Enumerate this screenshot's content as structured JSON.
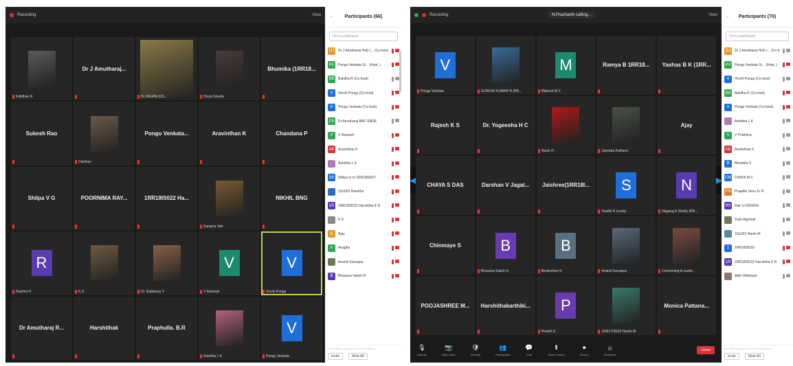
{
  "colors": {
    "accent_blue": "#1e6fd9",
    "mic_red": "#d33333",
    "highlight": "#c8d24a",
    "end_red": "#d9333b"
  },
  "left": {
    "recording": "Recording",
    "view": "View",
    "tiles": [
      {
        "type": "photo",
        "label": "Kalidhas N",
        "photo": "#5a5a5a"
      },
      {
        "type": "name",
        "name": "Dr J Amutharaj...",
        "label": ""
      },
      {
        "type": "photo",
        "label": "Dr. RAJAN (Ch...",
        "photo": "#8a7a45",
        "wide": true
      },
      {
        "type": "photo",
        "label": "Divya Gowda",
        "photo": "#4a3a3a"
      },
      {
        "type": "name",
        "name": "Bhumika (1RR18...",
        "label": ""
      },
      {
        "type": "name",
        "name": "Sukesh Rao",
        "label": ""
      },
      {
        "type": "photo",
        "label": "Chethan",
        "photo": "#6a5848"
      },
      {
        "type": "name",
        "name": "Pongu Venkata...",
        "label": ""
      },
      {
        "type": "name",
        "name": "Aravinthan K",
        "label": ""
      },
      {
        "type": "name",
        "name": "Chandana P",
        "label": ""
      },
      {
        "type": "name",
        "name": "Shilpa V G",
        "label": ""
      },
      {
        "type": "name",
        "name": "POORNIMA RAY...",
        "label": ""
      },
      {
        "type": "name",
        "name": "1RR18IS022 Ha...",
        "label": ""
      },
      {
        "type": "photo",
        "label": "Sanjana Jain",
        "photo": "#7a5a30"
      },
      {
        "type": "name",
        "name": "NIKHIL BNG",
        "label": ""
      },
      {
        "type": "avatar",
        "letter": "R",
        "color": "#5a3bb0",
        "label": "Rashmi H"
      },
      {
        "type": "photo",
        "label": "K.S",
        "photo": "#6e5a40"
      },
      {
        "type": "photo",
        "label": "Dr. Subbarao T",
        "photo": "#8a6048"
      },
      {
        "type": "avatar",
        "letter": "V",
        "color": "#1c8a6e",
        "label": "V Ramesh"
      },
      {
        "type": "avatar",
        "letter": "V",
        "color": "#1e6fd9",
        "label": "Vinchi Pongu",
        "hl": true
      },
      {
        "type": "name",
        "name": "Dr Amutharaj R...",
        "label": ""
      },
      {
        "type": "name",
        "name": "Harshithak",
        "label": ""
      },
      {
        "type": "name",
        "name": "Praphulla. B.R",
        "label": ""
      },
      {
        "type": "photo",
        "label": "Ashritha L K",
        "photo": "#b0607a"
      },
      {
        "type": "avatar",
        "letter": "V",
        "color": "#1e6fd9",
        "label": "Pongu Venkata"
      }
    ],
    "panel": {
      "title": "Participants (66)",
      "search": "Find a participant",
      "rows": [
        {
          "initials": "DJ",
          "color": "#e09a2a",
          "name": "Dr J Amutharaj HoD (... (Co-host, me)",
          "state": "red"
        },
        {
          "initials": "PV",
          "color": "#2fa84f",
          "name": "Pongu Venkata Sr... (Host, )",
          "state": "red"
        },
        {
          "initials": "BB",
          "color": "#2fa84f",
          "name": "Bakitha R (Co-host)",
          "state": "grey"
        },
        {
          "initials": "V",
          "color": "#1e6fd9",
          "name": "Vinchi Pongu (Co-host)",
          "state": "red"
        },
        {
          "initials": "V",
          "color": "#1e6fd9",
          "name": "Pongu Venkata (Co-host)",
          "state": "red"
        },
        {
          "initials": "DS",
          "color": "#2fa84f",
          "name": "Dr Amutharaj BNC EBDE",
          "state": "grey"
        },
        {
          "initials": "V",
          "color": "#2fa84f",
          "name": "V Ramesh",
          "state": "red"
        },
        {
          "initials": "AK",
          "color": "#d9333b",
          "name": "Aravinthan K",
          "state": "red"
        },
        {
          "initials": "",
          "color": "#b07ab8",
          "name": "Ashritha L K",
          "state": "red"
        },
        {
          "initials": "SK",
          "color": "#1e6fd9",
          "name": "Shilpa m in 1RR18IS007",
          "state": "red"
        },
        {
          "initials": "",
          "color": "#2a6fb8",
          "name": "1Ds020 Ramitha",
          "state": "red"
        },
        {
          "initials": "1R",
          "color": "#5a3bb0",
          "name": "1RR18IS022 Harshitha K N",
          "state": "red"
        },
        {
          "initials": "",
          "color": "#8a8a8a",
          "name": "K.S",
          "state": "red"
        },
        {
          "initials": "A",
          "color": "#e09a2a",
          "name": "Ajay",
          "state": "red"
        },
        {
          "initials": "A",
          "color": "#2fa84f",
          "name": "Anagha",
          "state": "red"
        },
        {
          "initials": "",
          "color": "#6a7a5a",
          "name": "Anand Guruapur",
          "state": "red"
        },
        {
          "initials": "B",
          "color": "#5a3bb0",
          "name": "Bhavana Satish N",
          "state": "red"
        }
      ],
      "footer": "Set Settings to show more Participants",
      "invite": "Invite",
      "mute": "Mute All"
    }
  },
  "right": {
    "recording": "Recording",
    "title": "N.Prashanth calling...",
    "view": "View",
    "tiles": [
      {
        "type": "avatar",
        "letter": "V",
        "color": "#1e6fd9",
        "label": "Pongu Venkata"
      },
      {
        "type": "photo",
        "label": "SURESH KUMAR B (RR...",
        "photo": "#3a6a9a"
      },
      {
        "type": "avatar",
        "letter": "M",
        "color": "#1c8a6e",
        "label": "Mahesh M C"
      },
      {
        "type": "name",
        "name": "Ramya B 1RR18...",
        "label": ""
      },
      {
        "type": "name",
        "name": "Yashas B K (1RR...",
        "label": ""
      },
      {
        "type": "name",
        "name": "Rajesh K S",
        "label": ""
      },
      {
        "type": "name",
        "name": "Dr. Yogeesha H C",
        "label": ""
      },
      {
        "type": "photo",
        "label": "Harsh H",
        "photo": "#b01818"
      },
      {
        "type": "photo",
        "label": "Upendra Kulkarni",
        "photo": "#4a5048"
      },
      {
        "type": "name",
        "name": "Ajay",
        "label": ""
      },
      {
        "type": "name",
        "name": "CHAYA S DAS",
        "label": ""
      },
      {
        "type": "name",
        "name": "Darshan V Jagat...",
        "label": ""
      },
      {
        "type": "name",
        "name": "Jaishree(1RR18I...",
        "label": ""
      },
      {
        "type": "avatar",
        "letter": "S",
        "color": "#1e6fd9",
        "label": "Swathi K Lovely"
      },
      {
        "type": "avatar",
        "letter": "N",
        "color": "#5a3bb0",
        "label": "Nagaraj K Shetty (RR..."
      },
      {
        "type": "name",
        "name": "Chinmaye S",
        "label": ""
      },
      {
        "type": "avatar",
        "letter": "B",
        "color": "#6a3bb0",
        "label": "Bhavana Satish N"
      },
      {
        "type": "avatar",
        "letter": "B",
        "color": "#5a7080",
        "label": "Bindushree K"
      },
      {
        "type": "photo",
        "label": "Anand Guruapur",
        "photo": "#5a6a7a"
      },
      {
        "type": "photo",
        "label": "Connecting to audio...",
        "photo": "#7a4a40"
      },
      {
        "type": "name",
        "name": "POOJASHREE M...",
        "label": ""
      },
      {
        "type": "name",
        "name": "Harshithakarthiki...",
        "label": ""
      },
      {
        "type": "avatar",
        "letter": "P",
        "color": "#6a3bb0",
        "label": "Preethi S"
      },
      {
        "type": "photo",
        "label": "1RR17IS022 Harish M",
        "photo": "#3a7a6a"
      },
      {
        "type": "name",
        "name": "Monica Pattana...",
        "label": ""
      }
    ],
    "toolbar": [
      {
        "name": "unmute",
        "glyph": "🎙",
        "label": "Unmute"
      },
      {
        "name": "start-video",
        "glyph": "📷",
        "label": "Start Video"
      },
      {
        "name": "security",
        "glyph": "🛡",
        "label": "Security"
      },
      {
        "name": "participants",
        "glyph": "👥",
        "label": "Participants"
      },
      {
        "name": "chat",
        "glyph": "💬",
        "label": "Chat"
      },
      {
        "name": "share-screen",
        "glyph": "⬆",
        "label": "Share Screen"
      },
      {
        "name": "record",
        "glyph": "⏺",
        "label": "Record"
      },
      {
        "name": "reactions",
        "glyph": "☺",
        "label": "Reactions"
      }
    ],
    "end": "Leave",
    "panel": {
      "title": "Participants (70)",
      "search": "Find a participant",
      "rows": [
        {
          "initials": "DJ",
          "color": "#e09a2a",
          "name": "Dr J Amutharaj HoD (... (Co-host, me)",
          "state": "grey"
        },
        {
          "initials": "PV",
          "color": "#2fa84f",
          "name": "Pongu Venkata Sr... (Host, )",
          "state": "red"
        },
        {
          "initials": "V",
          "color": "#1e6fd9",
          "name": "Vinchi Pongu (Co-host)",
          "state": "grey"
        },
        {
          "initials": "BB",
          "color": "#2fa84f",
          "name": "Bakitha R (Co-host)",
          "state": "red"
        },
        {
          "initials": "V",
          "color": "#1e6fd9",
          "name": "Pongu Venkata (Co-host)",
          "state": "red"
        },
        {
          "initials": "",
          "color": "#b07ab8",
          "name": "Ashritha L K",
          "state": "grey"
        },
        {
          "initials": "V",
          "color": "#2fa84f",
          "name": "V Prathima",
          "state": "grey"
        },
        {
          "initials": "AK",
          "color": "#d9333b",
          "name": "Aravinthan K",
          "state": "grey"
        },
        {
          "initials": "B",
          "color": "#1e6fd9",
          "name": "Bhumika S",
          "state": "grey"
        },
        {
          "initials": "CM",
          "color": "#1e6fd9",
          "name": "CHAYA M C",
          "state": "grey"
        },
        {
          "initials": "PN",
          "color": "#e0782a",
          "name": "Prajakta Venu N. R",
          "state": "grey"
        },
        {
          "initials": "RS",
          "color": "#5a3bb0",
          "name": "Rak 1rr18IS004",
          "state": "grey"
        },
        {
          "initials": "",
          "color": "#6a7a5a",
          "name": "Yash Agarwal",
          "state": "grey"
        },
        {
          "initials": "",
          "color": "#5a8a9a",
          "name": "1Ds022 Harsh M",
          "state": "grey"
        },
        {
          "initials": "1",
          "color": "#1e6fd9",
          "name": "1RR18IS033",
          "state": "red"
        },
        {
          "initials": "1R",
          "color": "#5a3bb0",
          "name": "1RR18IS022 Harshitha K N",
          "state": "red"
        },
        {
          "initials": "",
          "color": "#8a7a6a",
          "name": "Aditi Vilekhyan",
          "state": "grey"
        }
      ],
      "footer": "Set Settings to show more Participants",
      "invite": "Invite",
      "mute": "Mute All"
    }
  }
}
